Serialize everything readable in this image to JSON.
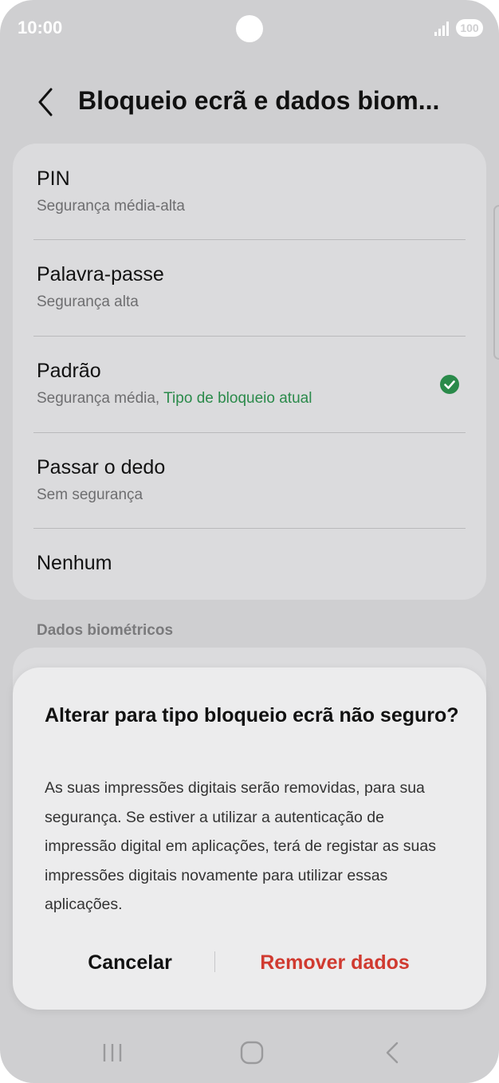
{
  "status_bar": {
    "time": "10:00",
    "battery": "100"
  },
  "header": {
    "title": "Bloqueio ecrã e dados biom..."
  },
  "lock_options": [
    {
      "title": "PIN",
      "subtitle": "Segurança média-alta"
    },
    {
      "title": "Palavra-passe",
      "subtitle": "Segurança alta"
    },
    {
      "title": "Padrão",
      "subtitle": "Segurança média,",
      "current_label": "Tipo de bloqueio atual"
    },
    {
      "title": "Passar o dedo",
      "subtitle": "Sem segurança"
    },
    {
      "title": "Nenhum"
    }
  ],
  "section": {
    "biometrics_label": "Dados biométricos"
  },
  "dialog": {
    "title": "Alterar para tipo bloqueio ecrã não seguro?",
    "body": "As suas impressões digitais serão removidas, para sua segurança. Se estiver a utilizar a autenticação de impressão digital em aplicações, terá de registar as suas impressões digitais novamente para utilizar essas aplicações.",
    "cancel_label": "Cancelar",
    "remove_label": "Remover dados"
  },
  "icons": {
    "back": "chevron-left-icon",
    "check": "check-circle-icon",
    "signal": "signal-icon",
    "nav_recent": "recent-apps-icon",
    "nav_home": "home-icon",
    "nav_back": "back-arrow-icon"
  },
  "colors": {
    "accent_green": "#2a8a4a",
    "destructive_red": "#d03a30",
    "scrim_background": "#cfcfd1"
  }
}
